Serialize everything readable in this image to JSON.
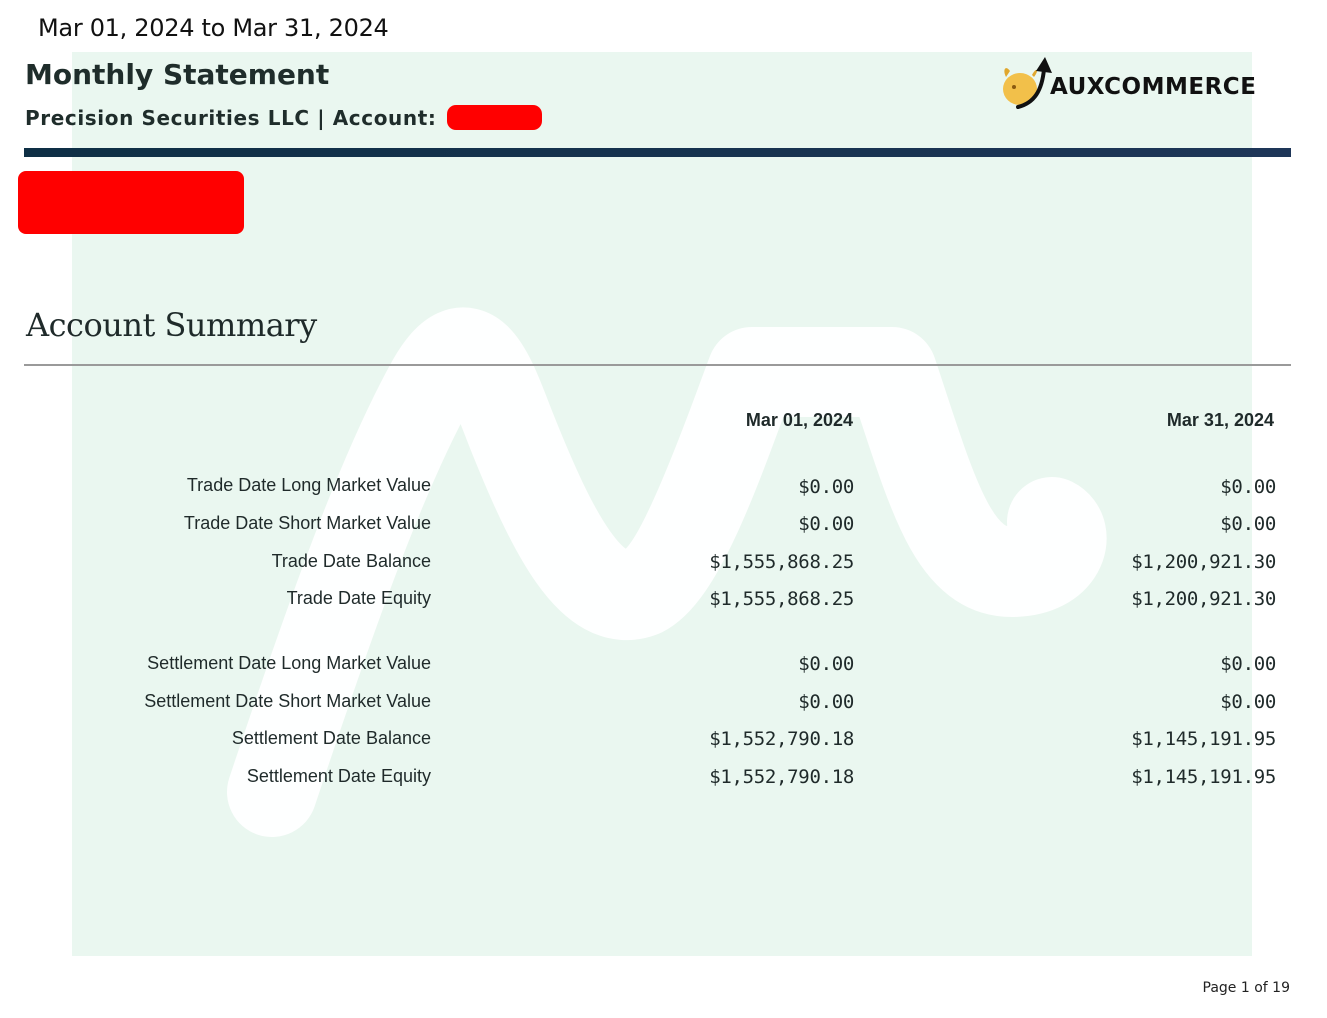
{
  "header": {
    "date_range": "Mar 01, 2024 to Mar 31, 2024",
    "title": "Monthly Statement",
    "subtitle": "Precision Securities LLC | Account:",
    "logo_text": "AUXCOMMERCE"
  },
  "summary": {
    "section_title": "Account Summary",
    "columns": [
      "Mar 01, 2024",
      "Mar 31, 2024"
    ],
    "rows": [
      {
        "label": "Trade Date Long Market Value",
        "start": "$0.00",
        "end": "$0.00"
      },
      {
        "label": "Trade Date Short Market Value",
        "start": "$0.00",
        "end": "$0.00"
      },
      {
        "label": "Trade Date Balance",
        "start": "$1,555,868.25",
        "end": "$1,200,921.30"
      },
      {
        "label": "Trade Date Equity",
        "start": "$1,555,868.25",
        "end": "$1,200,921.30"
      },
      {
        "label": "Settlement Date Long Market Value",
        "start": "$0.00",
        "end": "$0.00"
      },
      {
        "label": "Settlement Date Short Market Value",
        "start": "$0.00",
        "end": "$0.00"
      },
      {
        "label": "Settlement Date Balance",
        "start": "$1,552,790.18",
        "end": "$1,145,191.95"
      },
      {
        "label": "Settlement Date Equity",
        "start": "$1,552,790.18",
        "end": "$1,145,191.95"
      }
    ]
  },
  "footer": {
    "page_label": "Page 1 of 19"
  },
  "colors": {
    "accent_rule": "#0e2f45",
    "watermark_bg": "#eaf7f0",
    "redaction": "#ff0000",
    "logo_gold": "#f2c04a"
  },
  "icons": {
    "logo": "bull-arrow-logo-icon"
  }
}
